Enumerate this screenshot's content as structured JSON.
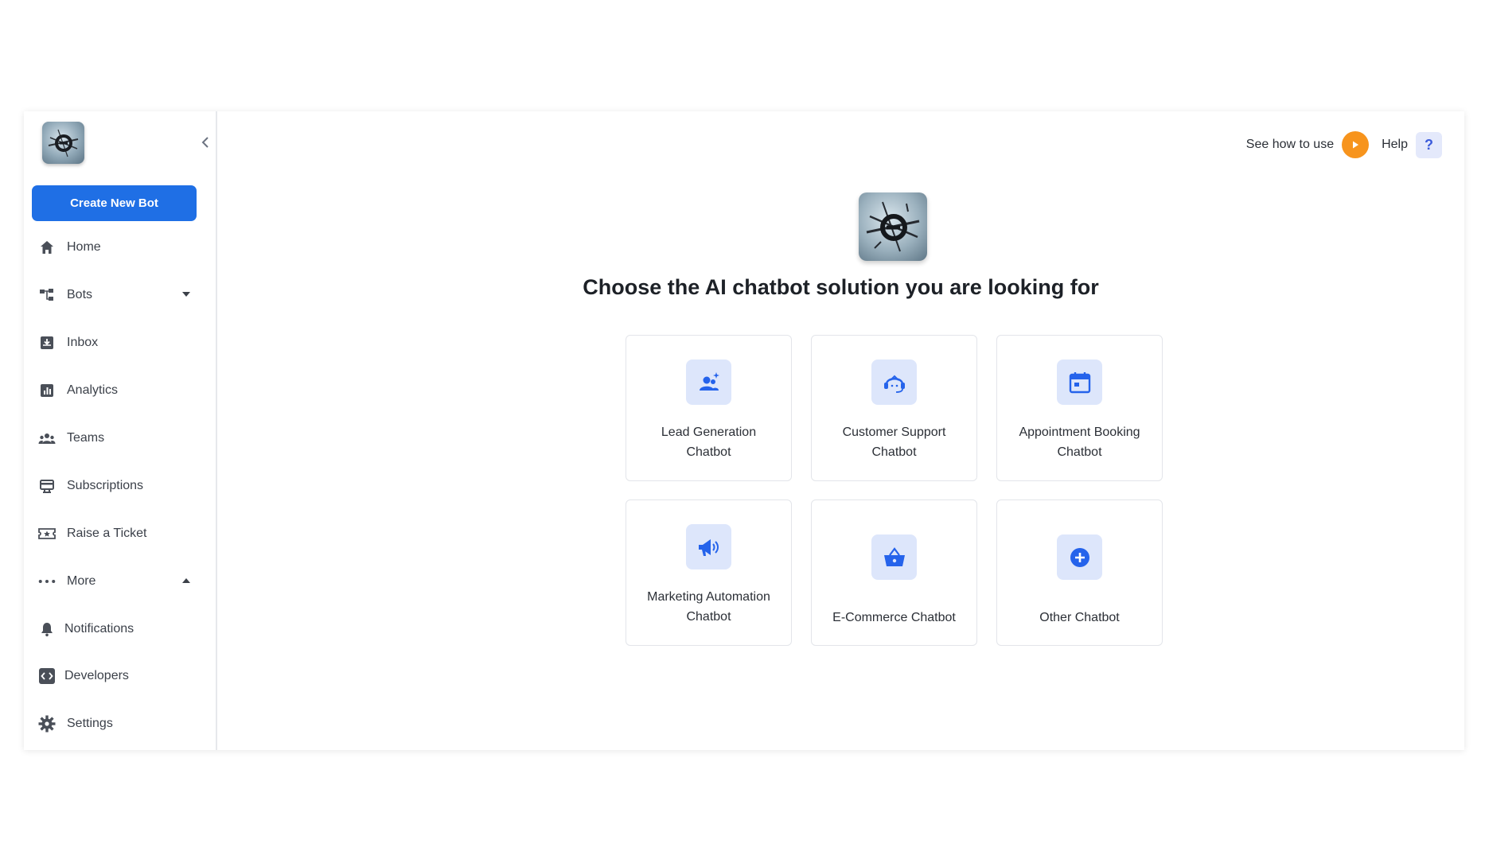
{
  "sidebar": {
    "create_button": "Create New Bot",
    "items": [
      {
        "label": "Home",
        "icon": "home-icon"
      },
      {
        "label": "Bots",
        "icon": "bots-icon"
      },
      {
        "label": "Inbox",
        "icon": "inbox-icon"
      },
      {
        "label": "Analytics",
        "icon": "analytics-icon"
      },
      {
        "label": "Teams",
        "icon": "teams-icon"
      },
      {
        "label": "Subscriptions",
        "icon": "subscriptions-icon"
      },
      {
        "label": "Raise a Ticket",
        "icon": "ticket-icon"
      },
      {
        "label": "More",
        "icon": "more-icon"
      },
      {
        "label": "Notifications",
        "icon": "bell-icon"
      },
      {
        "label": "Developers",
        "icon": "code-icon"
      },
      {
        "label": "Settings",
        "icon": "gear-icon"
      }
    ]
  },
  "topbar": {
    "see_how": "See how to use",
    "help": "Help",
    "help_symbol": "?"
  },
  "main": {
    "headline": "Choose the AI chatbot solution you are looking for",
    "cards": [
      {
        "line1": "Lead Generation",
        "line2": "Chatbot",
        "icon": "lead-icon"
      },
      {
        "line1": "Customer Support",
        "line2": "Chatbot",
        "icon": "support-icon"
      },
      {
        "line1": "Appointment Booking",
        "line2": "Chatbot",
        "icon": "calendar-icon"
      },
      {
        "line1": "Marketing Automation",
        "line2": "Chatbot",
        "icon": "megaphone-icon"
      },
      {
        "line1": "E-Commerce Chatbot",
        "line2": "",
        "icon": "basket-icon"
      },
      {
        "line1": "Other Chatbot",
        "line2": "",
        "icon": "plus-circle-icon"
      }
    ]
  },
  "colors": {
    "primary": "#1f6fe5",
    "accent_orange": "#f7941d",
    "icon_bg": "#dde6fb",
    "icon_fg": "#2563eb"
  }
}
